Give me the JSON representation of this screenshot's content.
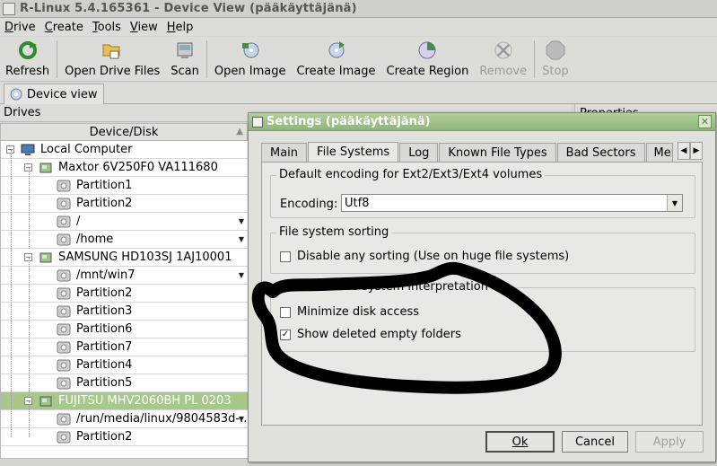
{
  "window": {
    "title": "R-Linux 5.4.165361 - Device View (pääkäyttäjänä)"
  },
  "menu": [
    {
      "label": "Drive",
      "u": "D",
      "rest": "rive"
    },
    {
      "label": "Create",
      "u": "C",
      "rest": "reate"
    },
    {
      "label": "Tools",
      "u": "T",
      "rest": "ools"
    },
    {
      "label": "View",
      "u": "V",
      "rest": "iew"
    },
    {
      "label": "Help",
      "u": "H",
      "rest": "elp"
    }
  ],
  "toolbar": {
    "refresh": "Refresh",
    "open_drive_files": "Open Drive Files",
    "scan": "Scan",
    "open_image": "Open Image",
    "create_image": "Create Image",
    "create_region": "Create Region",
    "remove": "Remove",
    "stop": "Stop"
  },
  "tabs": {
    "device_view": "Device view"
  },
  "panels": {
    "drives": "Drives",
    "properties": "Properties",
    "column_device": "Device/Disk"
  },
  "tree": [
    {
      "label": "Local Computer",
      "level": 0,
      "type": "computer"
    },
    {
      "label": "Maxtor 6V250F0 VA111680",
      "level": 1,
      "type": "disk"
    },
    {
      "label": "Partition1",
      "level": 2,
      "type": "partition"
    },
    {
      "label": "Partition2",
      "level": 2,
      "type": "partition"
    },
    {
      "label": "/",
      "level": 2,
      "type": "partition",
      "dropdown": true
    },
    {
      "label": "/home",
      "level": 2,
      "type": "partition",
      "dropdown": true
    },
    {
      "label": "SAMSUNG HD103SJ 1AJ10001",
      "level": 1,
      "type": "disk"
    },
    {
      "label": "/mnt/win7",
      "level": 2,
      "type": "partition",
      "dropdown": true
    },
    {
      "label": "Partition2",
      "level": 2,
      "type": "partition"
    },
    {
      "label": "Partition3",
      "level": 2,
      "type": "partition"
    },
    {
      "label": "Partition6",
      "level": 2,
      "type": "partition"
    },
    {
      "label": "Partition7",
      "level": 2,
      "type": "partition"
    },
    {
      "label": "Partition4",
      "level": 2,
      "type": "partition"
    },
    {
      "label": "Partition5",
      "level": 2,
      "type": "partition"
    },
    {
      "label": "FUJITSU MHV2060BH PL 0203",
      "level": 1,
      "type": "disk",
      "selected": true
    },
    {
      "label": "/run/media/linux/9804583d-...",
      "level": 2,
      "type": "partition",
      "dropdown": true
    },
    {
      "label": "Partition2",
      "level": 2,
      "type": "partition"
    }
  ],
  "dialog": {
    "title": "Settings (pääkäyttäjänä)",
    "tabs": [
      "Main",
      "File Systems",
      "Log",
      "Known File Types",
      "Bad Sectors",
      "Mem"
    ],
    "active_tab": "File Systems",
    "group_encoding": "Default encoding for Ext2/Ext3/Ext4 volumes",
    "encoding_label": "Encoding:",
    "encoding_value": "Utf8",
    "group_sorting": "File system sorting",
    "disable_sorting": "Disable any sorting (Use on huge file systems)",
    "disable_sorting_checked": false,
    "group_advanced": "Advanced file system interpretation",
    "minimize_disk": "Minimize disk access",
    "minimize_disk_checked": false,
    "show_deleted": "Show deleted empty folders",
    "show_deleted_checked": true,
    "ok": "Ok",
    "cancel": "Cancel",
    "apply": "Apply"
  },
  "colors": {
    "selection": "#a6c98a",
    "dialog_title": "#9dbf86"
  }
}
